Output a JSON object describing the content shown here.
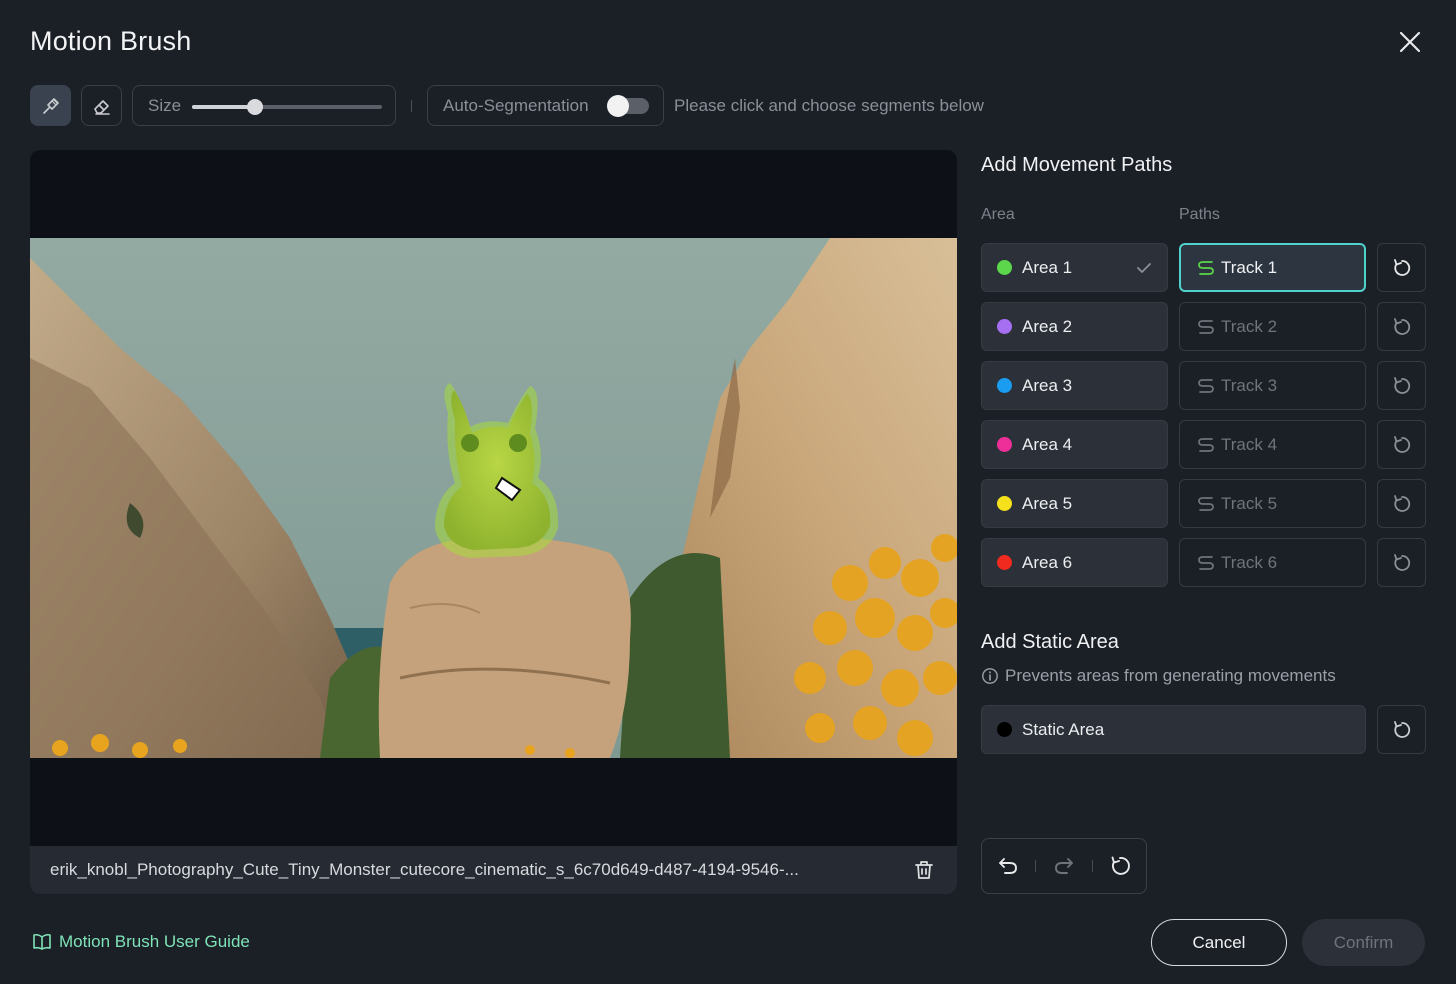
{
  "dialog": {
    "title": "Motion Brush"
  },
  "toolbar": {
    "size_label": "Size",
    "size_value": 0.33,
    "auto_segmentation_label": "Auto-Segmentation",
    "auto_segmentation_on": false,
    "hint": "Please click and choose segments below"
  },
  "canvas": {
    "file_name": "erik_knobl_Photography_Cute_Tiny_Monster_cutecore_cinematic_s_6c70d649-d487-4194-9546-..."
  },
  "movement": {
    "title": "Add Movement Paths",
    "area_header": "Area",
    "paths_header": "Paths",
    "rows": [
      {
        "area": "Area 1",
        "color": "#5cd64a",
        "track": "Track 1",
        "selected": true
      },
      {
        "area": "Area 2",
        "color": "#a66ef0",
        "track": "Track 2",
        "selected": false
      },
      {
        "area": "Area 3",
        "color": "#1a9cf0",
        "track": "Track 3",
        "selected": false
      },
      {
        "area": "Area 4",
        "color": "#ee2f9a",
        "track": "Track 4",
        "selected": false
      },
      {
        "area": "Area 5",
        "color": "#f5e01c",
        "track": "Track 5",
        "selected": false
      },
      {
        "area": "Area 6",
        "color": "#f02a1e",
        "track": "Track 6",
        "selected": false
      }
    ]
  },
  "static": {
    "title": "Add Static Area",
    "hint": "Prevents areas from generating movements",
    "label": "Static Area",
    "color": "#000000"
  },
  "footer": {
    "guide_label": "Motion Brush User Guide",
    "cancel_label": "Cancel",
    "confirm_label": "Confirm"
  },
  "colors": {
    "accent": "#4fd1cc",
    "guide": "#7fe3b8"
  }
}
